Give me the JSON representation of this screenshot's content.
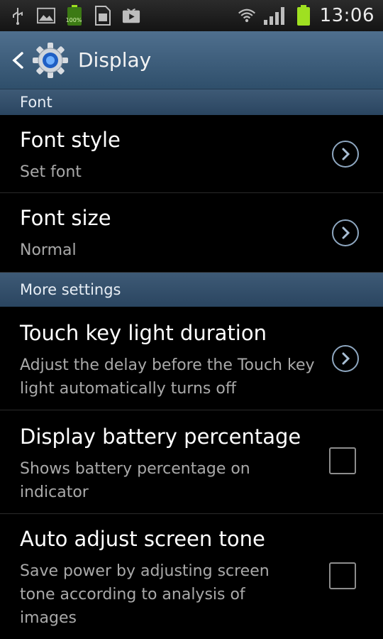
{
  "status_bar": {
    "time": "13:06",
    "battery_label": "100%",
    "icons": [
      "usb-icon",
      "image-icon",
      "battery-full-icon",
      "sim-icon",
      "video-icon",
      "wifi-icon",
      "signal-icon",
      "battery-icon"
    ],
    "battery_color": "#9fe021"
  },
  "header": {
    "title": "Display",
    "back_icon": "back-arrow-icon",
    "app_icon": "settings-gear-icon"
  },
  "sections": {
    "font": "Font",
    "more": "More settings"
  },
  "items": {
    "font_style": {
      "title": "Font style",
      "subtitle": "Set font"
    },
    "font_size": {
      "title": "Font size",
      "subtitle": "Normal"
    },
    "touch_key": {
      "title": "Touch key light duration",
      "subtitle": "Adjust the delay before the Touch key light automatically turns off"
    },
    "battery_pct": {
      "title": "Display battery percentage",
      "subtitle": "Shows battery percentage on indicator",
      "checked": false
    },
    "auto_tone": {
      "title": "Auto adjust screen tone",
      "subtitle": "Save power by adjusting screen tone according to analysis of images",
      "checked": false
    }
  },
  "colors": {
    "titlebar": "#3e5a76",
    "accent": "#8ea7c0"
  }
}
